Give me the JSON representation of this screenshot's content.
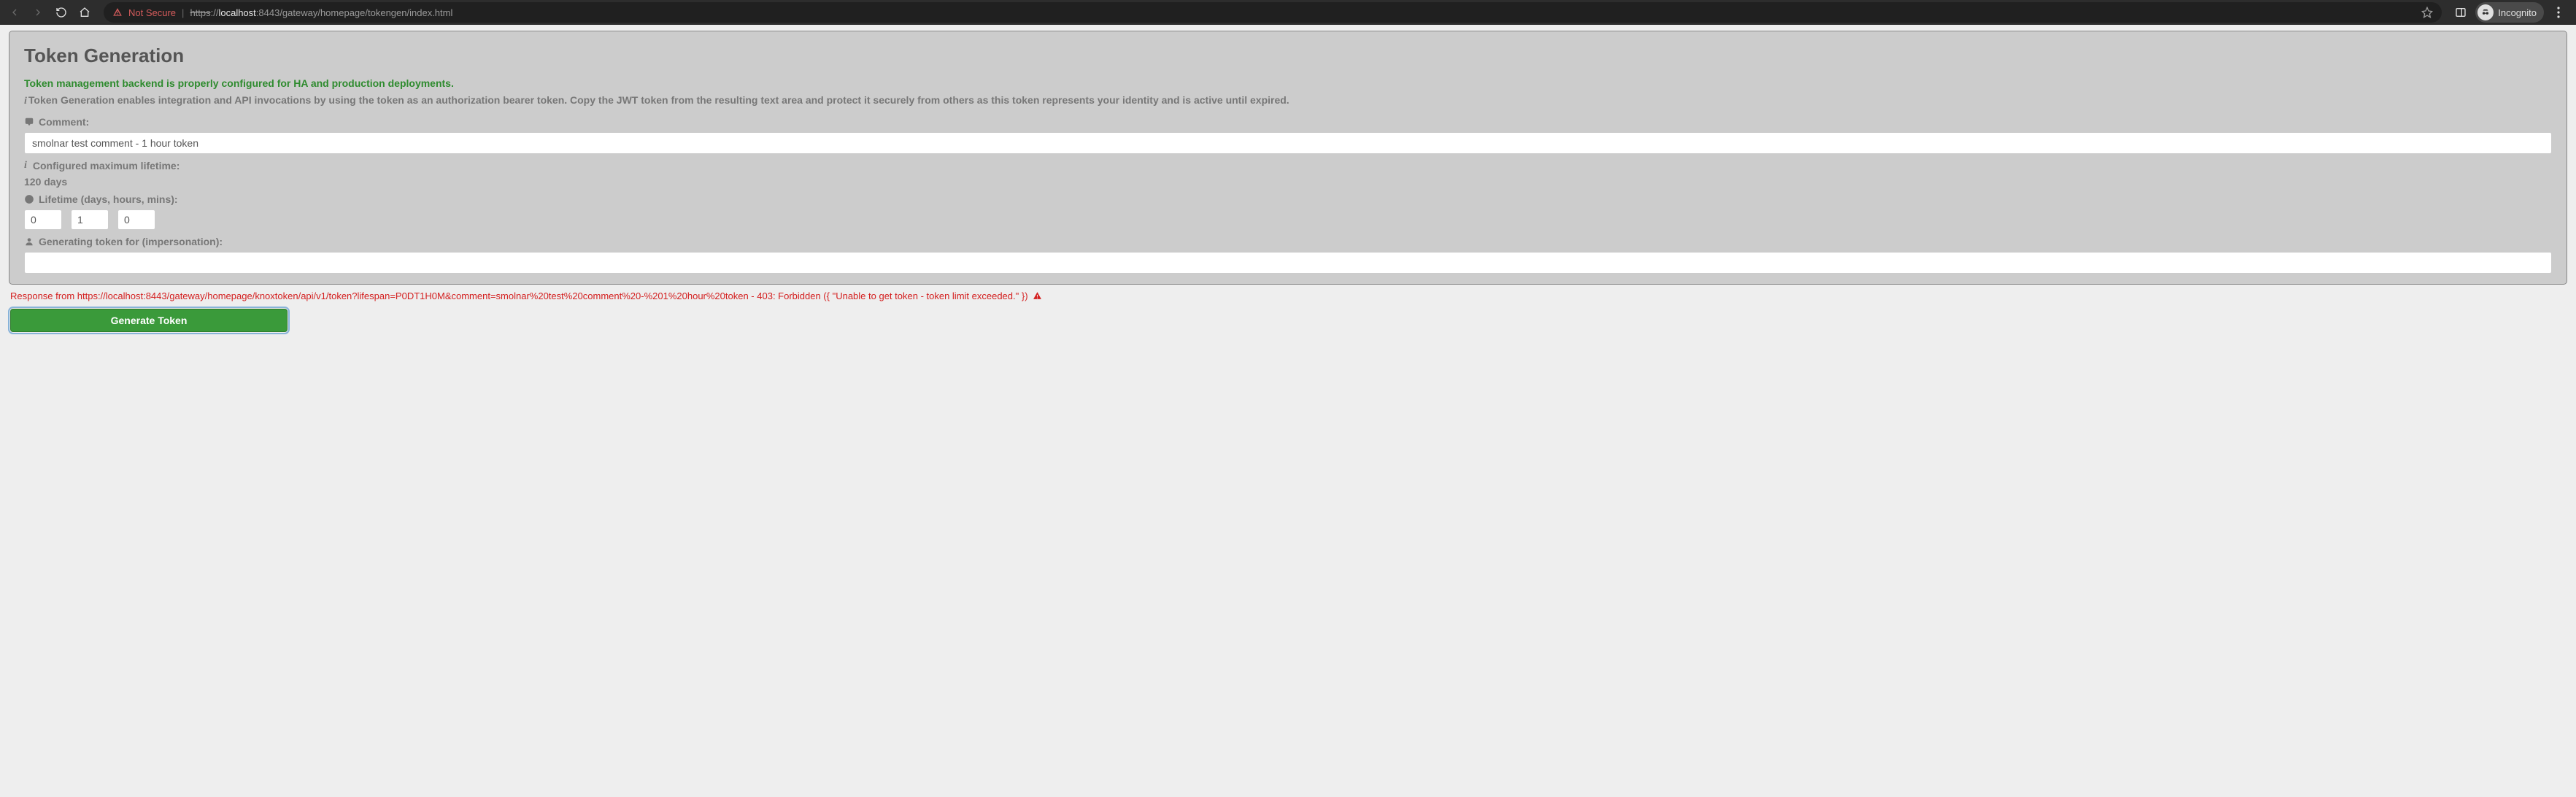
{
  "browser": {
    "not_secure_label": "Not Secure",
    "url_scheme": "https",
    "url_punct": "://",
    "url_host": "localhost",
    "url_port_path": ":8443/gateway/homepage/tokengen/index.html",
    "incognito_label": "Incognito"
  },
  "page": {
    "title": "Token Generation",
    "status_ok": "Token management backend is properly configured for HA and production deployments.",
    "info_text": "Token Generation enables integration and API invocations by using the token as an authorization bearer token. Copy the JWT token from the resulting text area and protect it securely from others as this token represents your identity and is active until expired.",
    "comment_label": "Comment:",
    "comment_value": "smolnar test comment - 1 hour token",
    "max_lifetime_label": "Configured maximum lifetime:",
    "max_lifetime_value": "120 days",
    "lifetime_label": "Lifetime (days, hours, mins):",
    "lifetime_days": "0",
    "lifetime_hours": "1",
    "lifetime_mins": "0",
    "impersonation_label": "Generating token for (impersonation):",
    "impersonation_value": "",
    "error_text": "Response from https://localhost:8443/gateway/homepage/knoxtoken/api/v1/token?lifespan=P0DT1H0M&comment=smolnar%20test%20comment%20-%201%20hour%20token - 403: Forbidden ({ \"Unable to get token - token limit exceeded.\" })",
    "generate_label": "Generate Token"
  }
}
